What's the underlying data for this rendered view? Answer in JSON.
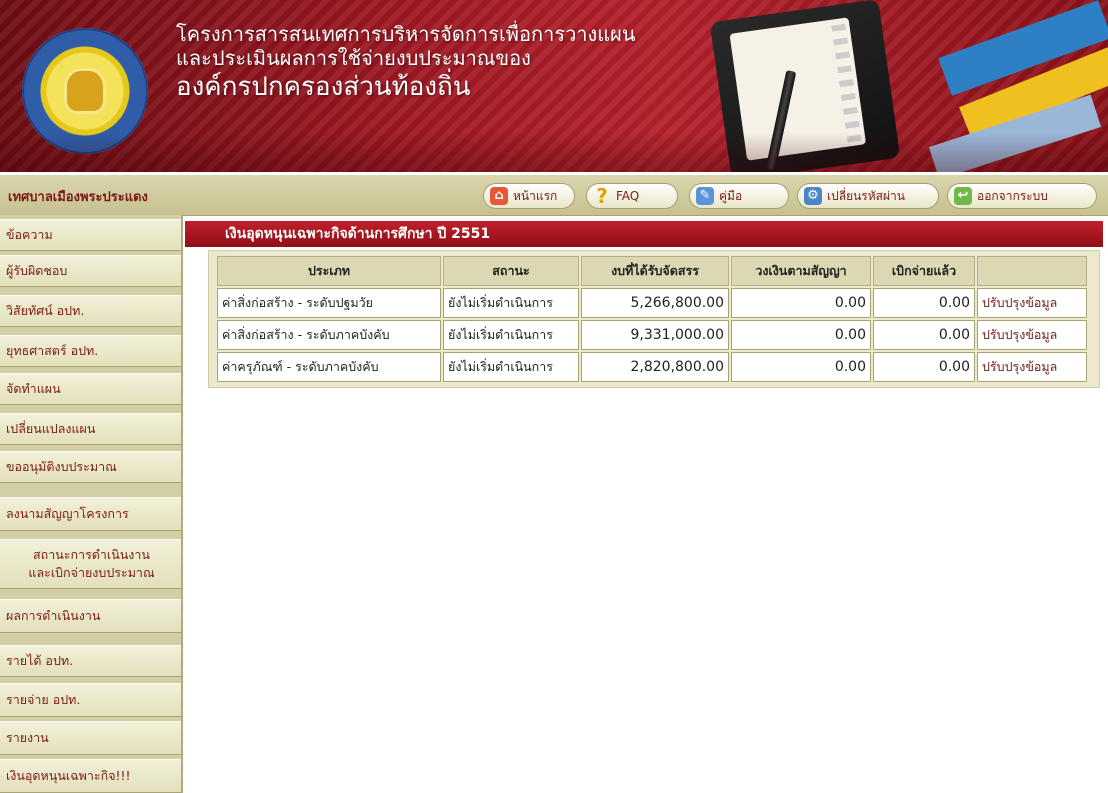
{
  "banner": {
    "title_line1": "โครงการสารสนเทศการบริหารจัดการเพื่อการวางแผน",
    "title_line2": "และประเมินผลการใช้จ่ายงบประมาณของ",
    "title_line3": "องค์กรปกครองส่วนท้องถิ่น",
    "accent": "#9c1722"
  },
  "topbar": {
    "org_name": "เทศบาลเมืองพระประแดง",
    "buttons": [
      {
        "label": "หน้าแรก",
        "icon": "home-icon"
      },
      {
        "label": "FAQ",
        "icon": "question-icon"
      },
      {
        "label": "คู่มือ",
        "icon": "pen-icon"
      },
      {
        "label": "เปลี่ยนรหัสผ่าน",
        "icon": "wrench-icon"
      },
      {
        "label": "ออกจากระบบ",
        "icon": "exit-icon"
      }
    ]
  },
  "sidebar": {
    "items": [
      {
        "label": "ข้อความ"
      },
      {
        "label": "ผู้รับผิดชอบ"
      },
      {
        "label": "วิสัยทัศน์ อปท."
      },
      {
        "label": "ยุทธศาสตร์ อปท."
      },
      {
        "label": "จัดทำแผน"
      },
      {
        "label": "เปลี่ยนแปลงแผน"
      },
      {
        "label": "ขออนุมัติงบประมาณ"
      },
      {
        "label": "ลงนามสัญญาโครงการ"
      },
      {
        "label": "สถานะการดำเนินงาน",
        "label2": "และเบิกจ่ายงบประมาณ"
      },
      {
        "label": "ผลการดำเนินงาน"
      },
      {
        "label": "รายได้ อปท."
      },
      {
        "label": "รายจ่าย อปท."
      },
      {
        "label": "รายงาน"
      },
      {
        "label": "เงินอุดหนุนเฉพาะกิจ!!!"
      }
    ]
  },
  "main": {
    "section_title": "เงินอุดหนุนเฉพาะกิจด้านการศึกษา ปี 2551",
    "columns": [
      "ประเภท",
      "สถานะ",
      "งบที่ได้รับจัดสรร",
      "วงเงินตามสัญญา",
      "เบิกจ่ายแล้ว",
      ""
    ],
    "rows": [
      {
        "type": "ค่าสิ่งก่อสร้าง - ระดับปฐมวัย",
        "status": "ยังไม่เริ่มดำเนินการ",
        "allocated": "5,266,800.00",
        "contract": "0.00",
        "paid": "0.00",
        "action": "ปรับปรุงข้อมูล"
      },
      {
        "type": "ค่าสิ่งก่อสร้าง - ระดับภาคบังคับ",
        "status": "ยังไม่เริ่มดำเนินการ",
        "allocated": "9,331,000.00",
        "contract": "0.00",
        "paid": "0.00",
        "action": "ปรับปรุงข้อมูล"
      },
      {
        "type": "ค่าครุภัณฑ์ - ระดับภาคบังคับ",
        "status": "ยังไม่เริ่มดำเนินการ",
        "allocated": "2,820,800.00",
        "contract": "0.00",
        "paid": "0.00",
        "action": "ปรับปรุงข้อมูล"
      }
    ]
  }
}
